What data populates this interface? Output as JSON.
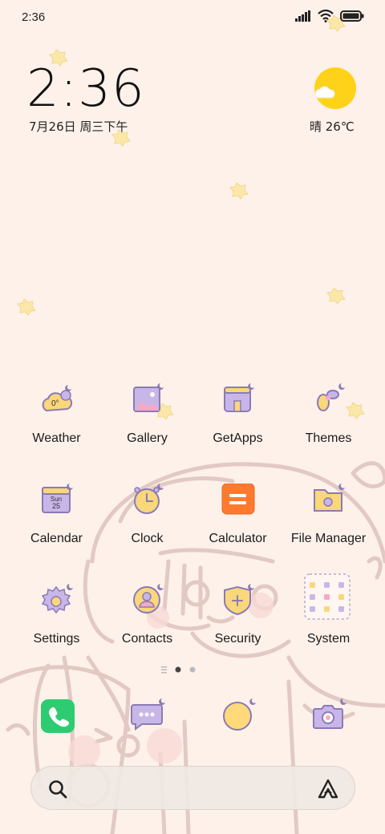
{
  "status_bar": {
    "time": "2:36"
  },
  "clock_widget": {
    "time": "2:36",
    "date": "7月26日 周三下午"
  },
  "weather_widget": {
    "condition_temp": "晴 26℃",
    "icon": "sun-cloud-icon"
  },
  "apps": [
    {
      "label": "Weather",
      "icon": "weather-icon",
      "badge": "0°"
    },
    {
      "label": "Gallery",
      "icon": "gallery-icon"
    },
    {
      "label": "GetApps",
      "icon": "getapps-icon"
    },
    {
      "label": "Themes",
      "icon": "themes-icon"
    },
    {
      "label": "Calendar",
      "icon": "calendar-icon",
      "day": "Sun",
      "date": "25"
    },
    {
      "label": "Clock",
      "icon": "clock-icon"
    },
    {
      "label": "Calculator",
      "icon": "calculator-icon"
    },
    {
      "label": "File Manager",
      "icon": "file-manager-icon"
    },
    {
      "label": "Settings",
      "icon": "settings-icon"
    },
    {
      "label": "Contacts",
      "icon": "contacts-icon"
    },
    {
      "label": "Security",
      "icon": "security-icon"
    },
    {
      "label": "System",
      "icon": "system-folder-icon"
    }
  ],
  "page_indicator": {
    "pages": 2,
    "current": 1
  },
  "dock": [
    {
      "icon": "phone-icon"
    },
    {
      "icon": "messages-icon"
    },
    {
      "icon": "browser-icon"
    },
    {
      "icon": "camera-icon"
    }
  ],
  "colors": {
    "background": "#fdf1ea",
    "icon_purple": "#c9b6e8",
    "icon_yellow": "#f9d77a",
    "icon_stroke": "#8a7bb5",
    "sun": "#ffd21a",
    "phone_green": "#2ecc71",
    "calculator_orange": "#ff7a2e"
  }
}
